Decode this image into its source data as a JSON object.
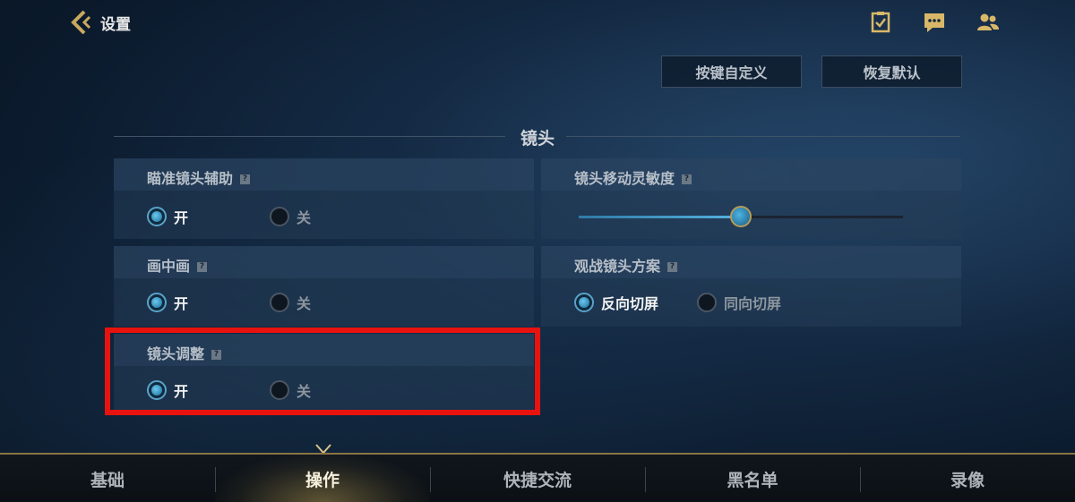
{
  "header": {
    "title": "设置",
    "icons": [
      "clipboard-check-icon",
      "chat-icon",
      "friends-icon"
    ]
  },
  "actions": {
    "custom_keys": "按键自定义",
    "restore_default": "恢复默认"
  },
  "section": {
    "title": "镜头"
  },
  "settings": {
    "aim_assist": {
      "title": "瞄准镜头辅助",
      "on": "开",
      "off": "关",
      "selected": "on"
    },
    "camera_sensitivity": {
      "title": "镜头移动灵敏度",
      "level": 0.5
    },
    "pip": {
      "title": "画中画",
      "on": "开",
      "off": "关",
      "selected": "on"
    },
    "spectate_camera": {
      "title": "观战镜头方案",
      "reverse": "反向切屏",
      "same": "同向切屏",
      "selected": "reverse"
    },
    "camera_adjust": {
      "title": "镜头调整",
      "on": "开",
      "off": "关",
      "selected": "on"
    }
  },
  "help_glyph": "?",
  "colors": {
    "accent": "#5aa2c8",
    "gold": "#8a7444",
    "highlight": "#e8130f"
  },
  "bottom_nav": {
    "tabs": [
      "基础",
      "操作",
      "快捷交流",
      "黑名单",
      "录像"
    ],
    "active_index": 1
  }
}
